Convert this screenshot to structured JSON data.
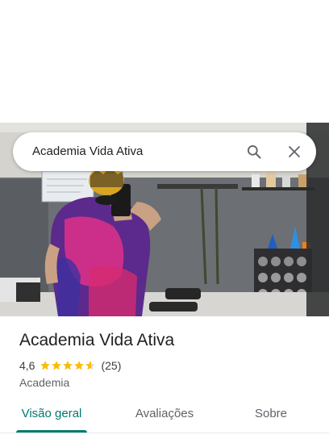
{
  "search": {
    "query": "Academia Vida Ativa",
    "search_icon": "search-icon",
    "close_icon": "close-icon"
  },
  "place": {
    "name": "Academia Vida Ativa",
    "rating": "4,6",
    "rating_value": 4.6,
    "stars_total": 5,
    "review_count": "(25)",
    "category": "Academia"
  },
  "tabs": [
    {
      "label": "Visão geral",
      "active": true
    },
    {
      "label": "Avaliações",
      "active": false
    },
    {
      "label": "Sobre",
      "active": false
    }
  ],
  "colors": {
    "accent": "#01796f",
    "star": "#fbbc04",
    "star_empty": "#dadce0",
    "text_primary": "#202124",
    "text_secondary": "#5f6368"
  }
}
